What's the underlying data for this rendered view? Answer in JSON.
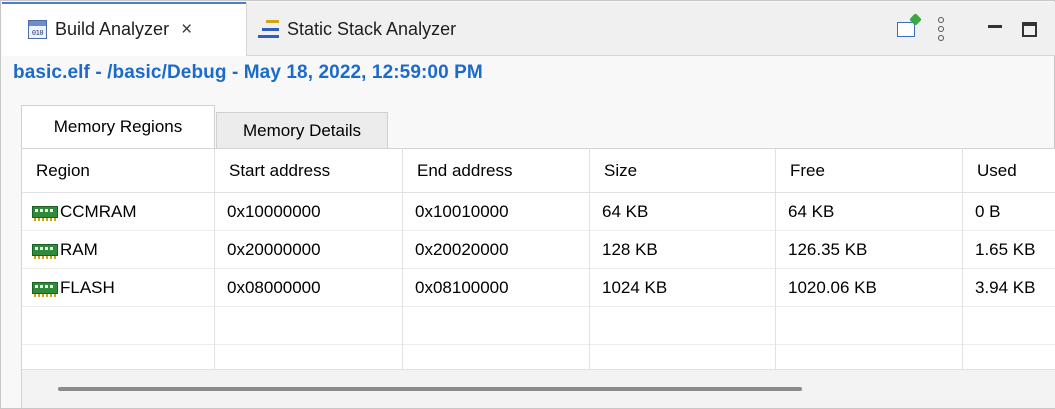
{
  "view_tabs": [
    {
      "label": "Build Analyzer",
      "icon": "binary-file-icon",
      "active": true,
      "close": "×"
    },
    {
      "label": "Static Stack Analyzer",
      "icon": "stack-icon",
      "active": false
    }
  ],
  "toolbar_icons": [
    "pin-icon",
    "view-menu-icon",
    "minimize-icon",
    "maximize-icon"
  ],
  "header": {
    "title": "basic.elf - /basic/Debug - May 18, 2022, 12:59:00 PM"
  },
  "folder_tabs": [
    {
      "label": "Memory Regions",
      "selected": true
    },
    {
      "label": "Memory Details",
      "selected": false
    }
  ],
  "table": {
    "columns": [
      "Region",
      "Start address",
      "End address",
      "Size",
      "Free",
      "Used"
    ],
    "rows": [
      {
        "region": "CCMRAM",
        "start": "0x10000000",
        "end": "0x10010000",
        "size": "64 KB",
        "free": "64 KB",
        "used": "0 B"
      },
      {
        "region": "RAM",
        "start": "0x20000000",
        "end": "0x20020000",
        "size": "128 KB",
        "free": "126.35 KB",
        "used": "1.65 KB"
      },
      {
        "region": "FLASH",
        "start": "0x08000000",
        "end": "0x08100000",
        "size": "1024 KB",
        "free": "1020.06 KB",
        "used": "3.94 KB"
      }
    ]
  },
  "colors": {
    "title": "#1c6ac9",
    "memory_icon": "#2e8b3a",
    "active_tab_accent": "#4a7fd0"
  }
}
